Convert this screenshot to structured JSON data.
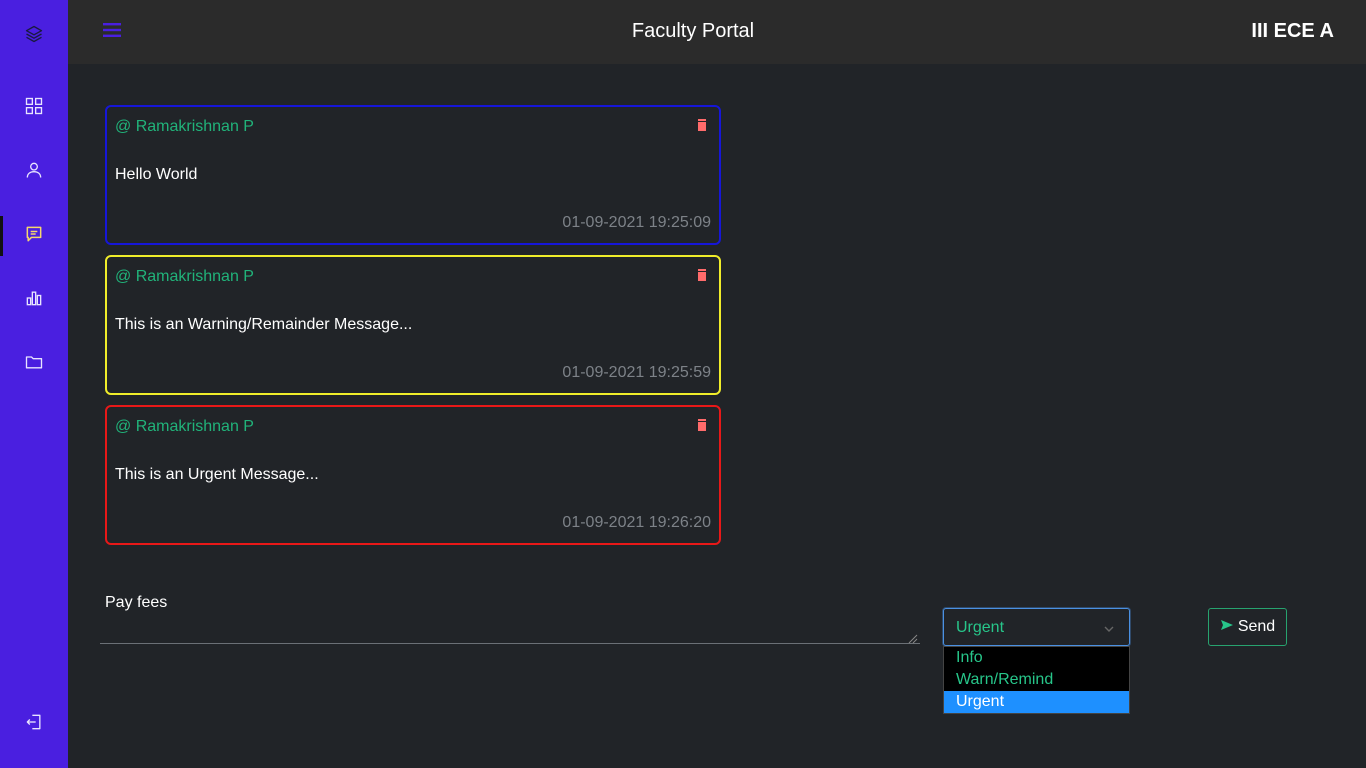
{
  "header": {
    "title": "Faculty Portal",
    "class_label": "III ECE A"
  },
  "sidebar": {
    "items": [
      {
        "icon": "layers-icon"
      },
      {
        "icon": "grid-icon"
      },
      {
        "icon": "user-icon"
      },
      {
        "icon": "message-icon",
        "active": true
      },
      {
        "icon": "bar-chart-icon"
      },
      {
        "icon": "folder-icon"
      }
    ],
    "logout_icon": "logout-icon"
  },
  "messages": [
    {
      "author": "@ Ramakrishnan P",
      "text": "Hello World",
      "time": "01-09-2021 19:25:09",
      "type": "info",
      "color": "#1616d8"
    },
    {
      "author": "@ Ramakrishnan P",
      "text": "This is an Warning/Remainder Message...",
      "time": "01-09-2021 19:25:59",
      "type": "warn",
      "color": "#f0ed2a"
    },
    {
      "author": "@ Ramakrishnan P",
      "text": "This is an Urgent Message...",
      "time": "01-09-2021 19:26:20",
      "type": "urgent",
      "color": "#e81818"
    }
  ],
  "compose": {
    "value": "Pay fees"
  },
  "priority_select": {
    "selected": "Urgent",
    "options": [
      "Info",
      "Warn/Remind",
      "Urgent"
    ]
  },
  "send_button": {
    "label": "Send"
  },
  "colors": {
    "sidebar": "#4a1fe0",
    "accent_green": "#27c68a",
    "background": "#212428",
    "topbar": "#2b2b2b"
  }
}
